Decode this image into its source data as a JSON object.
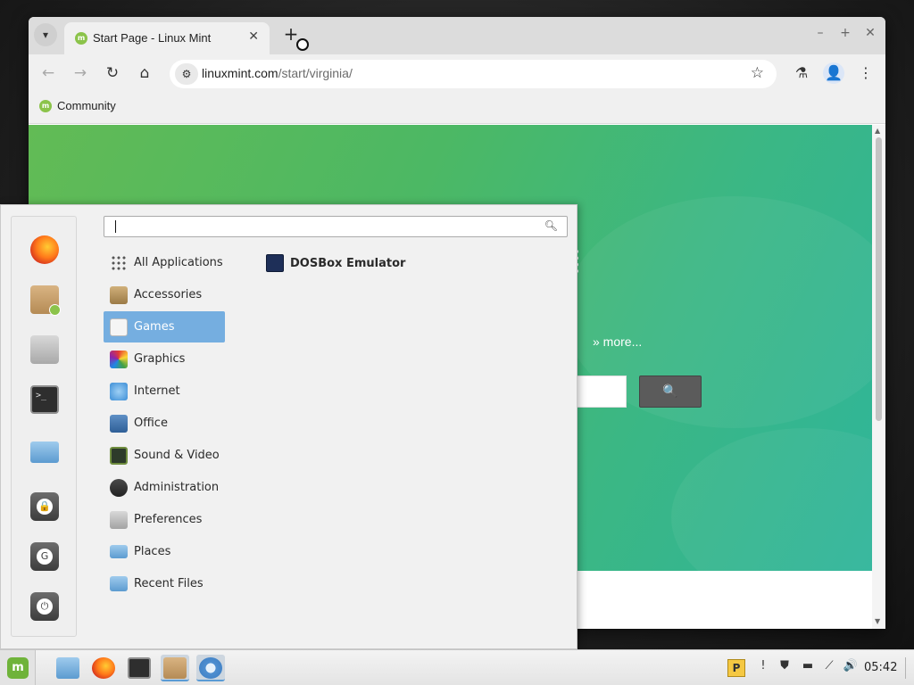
{
  "browser": {
    "tab": {
      "title": "Start Page - Linux Mint",
      "favicon": "linux-mint-icon"
    },
    "url": {
      "host": "linuxmint.com",
      "path": "/start/virginia/"
    },
    "bookmarks": [
      {
        "label": "Community",
        "icon": "linux-mint-icon"
      }
    ],
    "icons": {
      "tab_list": "▾",
      "tab_close": "✕",
      "new_tab": "+",
      "minimize": "–",
      "maximize": "+",
      "close": "✕",
      "back": "←",
      "forward": "→",
      "reload": "↻",
      "home": "⌂",
      "site_info": "⚙",
      "star": "☆",
      "labs": "⚗",
      "profile": "👤",
      "menu": "⋮"
    }
  },
  "page": {
    "more_link": "» more...",
    "search_button_icon": "🔍"
  },
  "start_menu": {
    "search": {
      "value": "",
      "icon": "search-icon"
    },
    "favorites": [
      {
        "name": "firefox"
      },
      {
        "name": "software-manager"
      },
      {
        "name": "system-settings"
      },
      {
        "name": "terminal"
      },
      {
        "name": "files"
      },
      {
        "name": "lock-screen",
        "glyph": "🔒"
      },
      {
        "name": "logout",
        "glyph": "G"
      },
      {
        "name": "shutdown",
        "glyph": "⏻"
      }
    ],
    "categories": [
      {
        "label": "All Applications",
        "icon": "grid-icon"
      },
      {
        "label": "Accessories",
        "icon": "accessories-icon"
      },
      {
        "label": "Games",
        "icon": "games-icon",
        "selected": true
      },
      {
        "label": "Graphics",
        "icon": "graphics-icon"
      },
      {
        "label": "Internet",
        "icon": "internet-icon"
      },
      {
        "label": "Office",
        "icon": "office-icon"
      },
      {
        "label": "Sound & Video",
        "icon": "sound-video-icon"
      },
      {
        "label": "Administration",
        "icon": "administration-icon"
      },
      {
        "label": "Preferences",
        "icon": "preferences-icon"
      },
      {
        "label": "Places",
        "icon": "folder-icon"
      },
      {
        "label": "Recent Files",
        "icon": "recent-files-icon"
      }
    ],
    "applications": [
      {
        "label": "DOSBox Emulator",
        "icon": "dosbox-icon"
      }
    ]
  },
  "panel": {
    "menu_logo": "m",
    "tray": {
      "p_indicator": "P",
      "update": "!",
      "shield": "⛊",
      "keyboard": "▬",
      "network": "⟋",
      "volume": "🔊"
    },
    "clock": "05:42"
  },
  "colors": {
    "accent_selection": "#75aee0",
    "mint_green": "#8bc34a",
    "hero_start": "#62bb55",
    "hero_end": "#2fb59a"
  }
}
